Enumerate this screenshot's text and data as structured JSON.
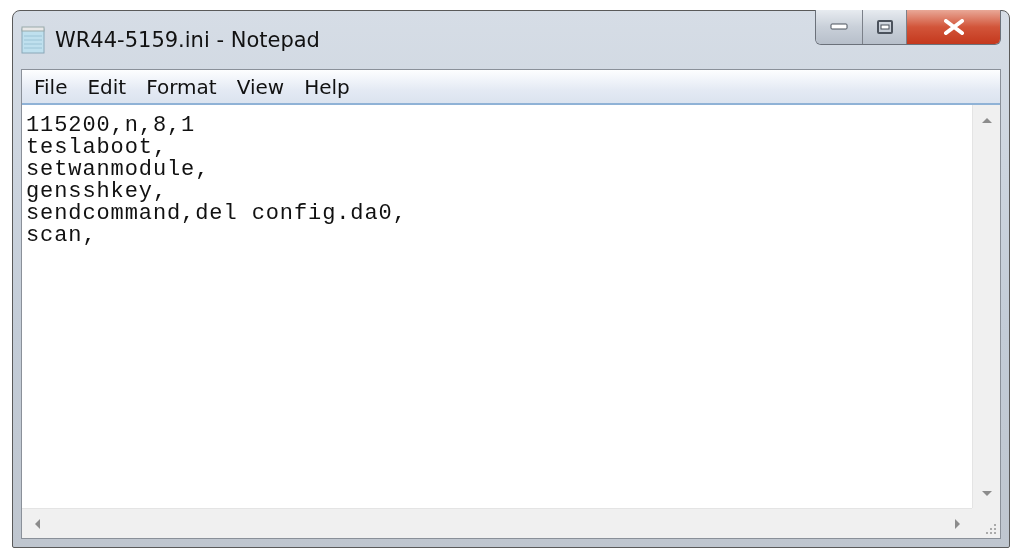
{
  "window": {
    "title": "WR44-5159.ini - Notepad"
  },
  "menu": [
    "File",
    "Edit",
    "Format",
    "View",
    "Help"
  ],
  "document": {
    "lines": [
      "115200,n,8,1",
      "teslaboot,",
      "setwanmodule,",
      "gensshkey,",
      "sendcommand,del config.da0,",
      "scan,"
    ]
  }
}
